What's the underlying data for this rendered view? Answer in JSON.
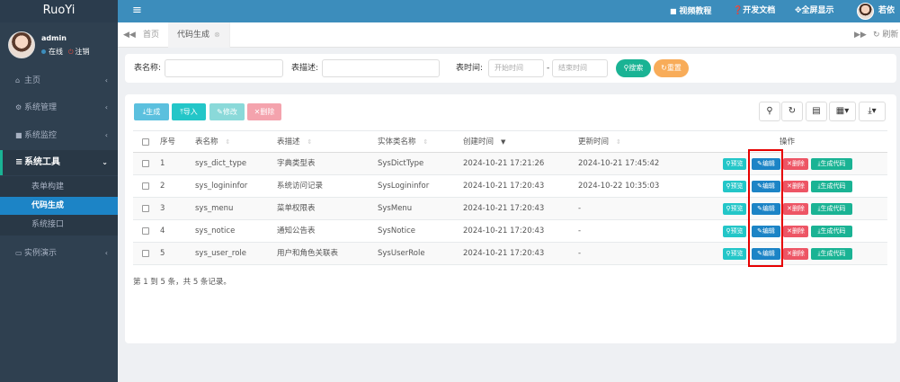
{
  "app": {
    "logo": "RuoYi"
  },
  "user": {
    "name": "admin",
    "status": "在线",
    "logout": "注销"
  },
  "sidebar": {
    "items": [
      {
        "label": "主页",
        "icon": "home-icon"
      },
      {
        "label": "系统管理",
        "icon": "gear-icon"
      },
      {
        "label": "系统监控",
        "icon": "video-icon"
      },
      {
        "label": "系统工具",
        "icon": "bars-icon"
      },
      {
        "label": "实例演示",
        "icon": "desktop-icon"
      }
    ],
    "subitems": [
      {
        "label": "表单构建"
      },
      {
        "label": "代码生成"
      },
      {
        "label": "系统接口"
      }
    ]
  },
  "topbar": {
    "video": "视频教程",
    "docs": "开发文档",
    "fullscreen": "全屏显示",
    "username": "若依"
  },
  "tabs": {
    "home": "首页",
    "active": "代码生成",
    "refresh": "刷新"
  },
  "search": {
    "table_name_label": "表名称:",
    "table_desc_label": "表描述:",
    "time_label": "表时间:",
    "start_placeholder": "开始时间",
    "sep": "-",
    "end_placeholder": "结束时间",
    "search_btn": "搜索",
    "reset_btn": "重置"
  },
  "toolbar": {
    "generate": "生成",
    "import": "导入",
    "edit": "修改",
    "delete": "删除"
  },
  "table": {
    "headers": [
      "序号",
      "表名称",
      "表描述",
      "实体类名称",
      "创建时间",
      "更新时间",
      "操作"
    ],
    "rows": [
      [
        "1",
        "sys_dict_type",
        "字典类型表",
        "SysDictType",
        "2024-10-21 17:21:26",
        "2024-10-21 17:45:42"
      ],
      [
        "2",
        "sys_logininfor",
        "系统访问记录",
        "SysLogininfor",
        "2024-10-21 17:20:43",
        "2024-10-22 10:35:03"
      ],
      [
        "3",
        "sys_menu",
        "菜单权限表",
        "SysMenu",
        "2024-10-21 17:20:43",
        "-"
      ],
      [
        "4",
        "sys_notice",
        "通知公告表",
        "SysNotice",
        "2024-10-21 17:20:43",
        "-"
      ],
      [
        "5",
        "sys_user_role",
        "用户和角色关联表",
        "SysUserRole",
        "2024-10-21 17:20:43",
        "-"
      ]
    ],
    "actions": {
      "preview": "预览",
      "edit": "编辑",
      "delete": "删除",
      "gencode": "生成代码"
    },
    "footer": "第 1 到 5 条，共 5 条记录。"
  },
  "colors": {
    "sidebar_bg": "#2f4050",
    "topbar_bg": "#3c8dbc",
    "active_submenu": "#1c84c6",
    "search_btn": "#1ab394",
    "reset_btn": "#f8ac59",
    "btn_info": "#23c6c8",
    "btn_primary": "#1c84c6",
    "btn_danger": "#ed5565",
    "highlight": "#e60000"
  }
}
